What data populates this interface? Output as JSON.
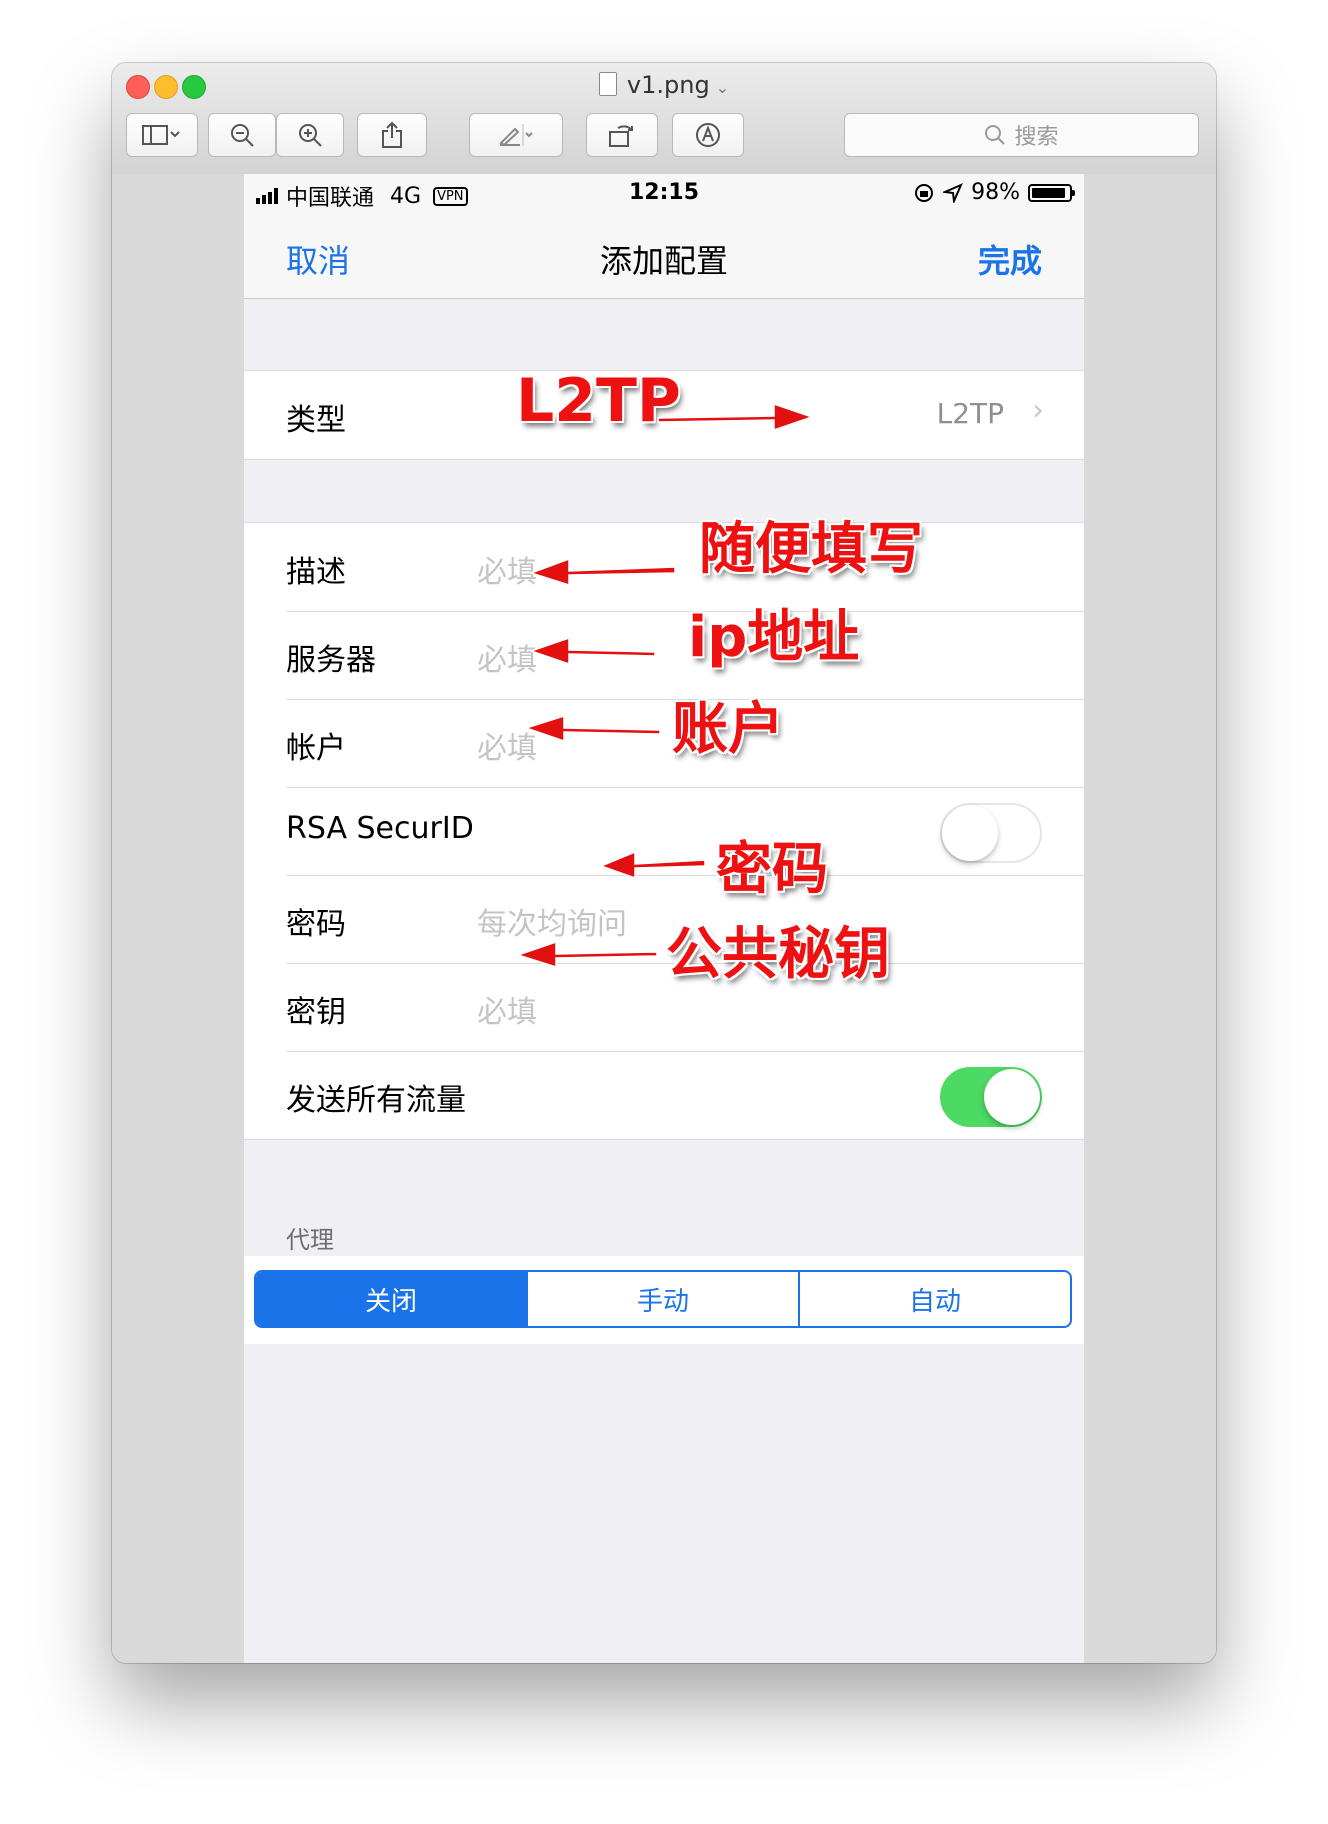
{
  "window": {
    "filename": "v1.png",
    "search_placeholder": "搜索"
  },
  "status_bar": {
    "carrier": "中国联通",
    "network": "4G",
    "vpn_badge": "VPN",
    "time": "12:15",
    "battery": "98%"
  },
  "nav": {
    "cancel": "取消",
    "title": "添加配置",
    "done": "完成"
  },
  "type_row": {
    "label": "类型",
    "value": "L2TP"
  },
  "fields": [
    {
      "label": "描述",
      "placeholder": "必填"
    },
    {
      "label": "服务器",
      "placeholder": "必填"
    },
    {
      "label": "帐户",
      "placeholder": "必填"
    },
    {
      "label": "RSA SecurID",
      "toggle": false
    },
    {
      "label": "密码",
      "placeholder": "每次均询问"
    },
    {
      "label": "密钥",
      "placeholder": "必填"
    },
    {
      "label": "发送所有流量",
      "toggle": true
    }
  ],
  "proxy": {
    "header": "代理",
    "options": [
      "关闭",
      "手动",
      "自动"
    ],
    "selected": "关闭"
  },
  "annotations": {
    "type": "L2TP",
    "description": "随便填写",
    "server": "ip地址",
    "account": "账户",
    "password": "密码",
    "secret": "公共秘钥"
  },
  "colors": {
    "ios_blue": "#1a73e8",
    "toggle_on": "#4cd964",
    "annotation_red": "#ee1111"
  }
}
